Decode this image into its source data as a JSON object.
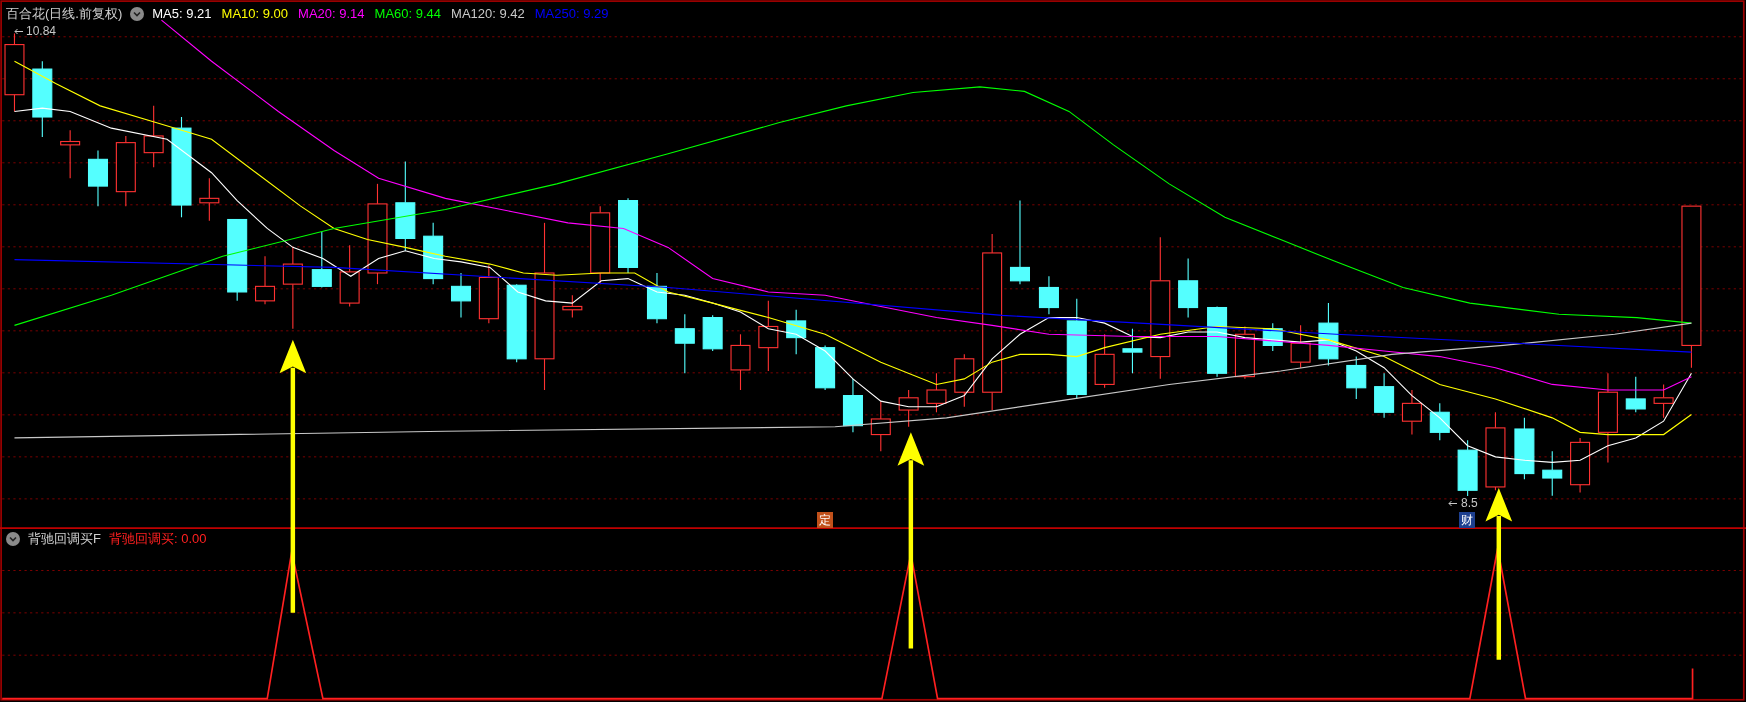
{
  "main_panel": {
    "title": "百合花(日线.前复权)",
    "moving_averages": [
      {
        "label": "MA5: 9.21",
        "color": "#ffffff"
      },
      {
        "label": "MA10: 9.00",
        "color": "#ffff00"
      },
      {
        "label": "MA20: 9.14",
        "color": "#ff00ff"
      },
      {
        "label": "MA60: 9.44",
        "color": "#00ff00"
      },
      {
        "label": "MA120: 9.42",
        "color": "#c8c8c8"
      },
      {
        "label": "MA250: 9.29",
        "color": "#0000ff"
      }
    ],
    "high_label": "10.84",
    "low_label": "8.5",
    "markers": [
      {
        "text": "定",
        "color": "#c0501a"
      },
      {
        "text": "财",
        "color": "#1d3f8f"
      }
    ]
  },
  "indicator_panel": {
    "title": "背驰回调买F",
    "value": "背驰回调买: 0.00"
  }
}
